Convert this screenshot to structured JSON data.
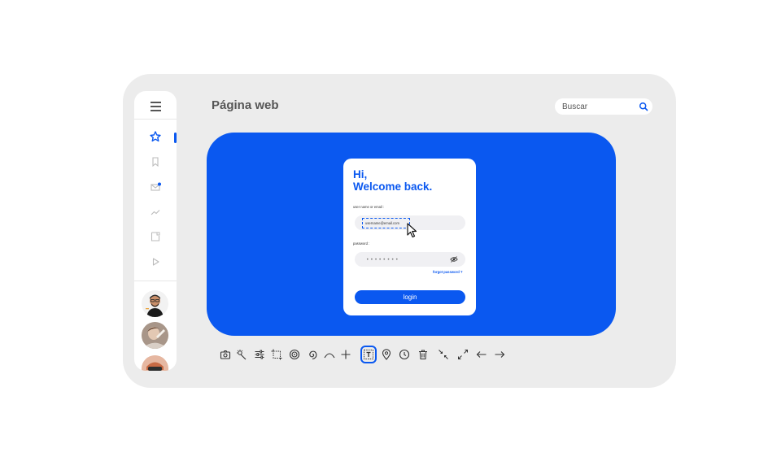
{
  "page": {
    "title": "Página web"
  },
  "search": {
    "placeholder": "Buscar"
  },
  "sidebar": {
    "items": [
      {
        "name": "star",
        "active": true
      },
      {
        "name": "bookmark"
      },
      {
        "name": "mail"
      },
      {
        "name": "trending"
      },
      {
        "name": "document"
      },
      {
        "name": "play"
      }
    ]
  },
  "login_card": {
    "greeting_line1": "Hi,",
    "greeting_line2": "Welcome back.",
    "username_label": "user name or email :",
    "username_value": "username@email.com",
    "password_label": "password :",
    "password_value": "••••••••",
    "forgot_link": "forgot password ?",
    "login_button": "login"
  },
  "colors": {
    "accent": "#0a58f0",
    "device_bg": "#ececec",
    "card_bg": "#ffffff"
  },
  "toolbar": {
    "tools": [
      "camera-icon",
      "magic-wand-icon",
      "adjust-icon",
      "crop-icon",
      "spiral-icon",
      "spiral2-icon",
      "arc-icon",
      "plus-icon",
      "text-tool-icon",
      "location-pin-icon",
      "clock-icon",
      "trash-icon",
      "shrink-icon",
      "expand-icon",
      "arrow-left-icon",
      "arrow-right-icon"
    ],
    "selected": "text-tool-icon"
  }
}
